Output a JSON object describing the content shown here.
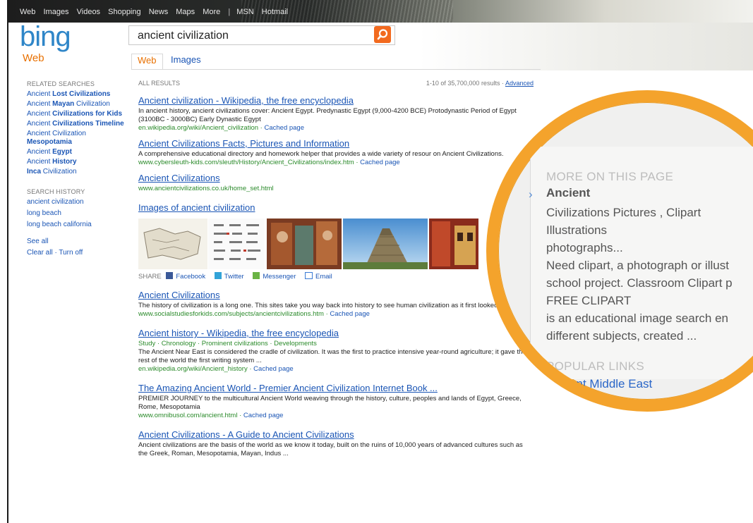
{
  "topnav": [
    "Web",
    "Images",
    "Videos",
    "Shopping",
    "News",
    "Maps",
    "More",
    "|",
    "MSN",
    "Hotmail"
  ],
  "logo": "bing",
  "vertical": "Web",
  "search": {
    "value": "ancient civilization"
  },
  "tabs": {
    "web": "Web",
    "images": "Images"
  },
  "sidebar": {
    "related_heading": "RELATED SEARCHES",
    "related": [
      {
        "pre": "Ancient ",
        "bold": "Lost Civilizations",
        "post": ""
      },
      {
        "pre": "Ancient ",
        "bold": "Mayan",
        "post": " Civilization"
      },
      {
        "pre": "Ancient ",
        "bold": "Civilizations for Kids",
        "post": ""
      },
      {
        "pre": "Ancient ",
        "bold": "Civilizations Timeline",
        "post": ""
      },
      {
        "pre": "Ancient Civilization ",
        "bold": "Mesopotamia",
        "post": ""
      },
      {
        "pre": "Ancient ",
        "bold": "Egypt",
        "post": ""
      },
      {
        "pre": "Ancient ",
        "bold": "History",
        "post": ""
      },
      {
        "pre": "",
        "bold": "Inca",
        "post": " Civilization"
      }
    ],
    "history_heading": "SEARCH HISTORY",
    "history": [
      "ancient civilization",
      "long beach",
      "long beach california"
    ],
    "see_all": "See all",
    "clear_all": "Clear all · Turn off"
  },
  "results_header": {
    "label": "ALL RESULTS",
    "count": "1-10 of 35,700,000 results ·",
    "advanced": "Advanced"
  },
  "results": [
    {
      "title": "Ancient civilization - Wikipedia, the free encyclopedia",
      "snippet": "In ancient history, ancient civilizations cover: Ancient Egypt. Predynastic Egypt (9,000-4200 BCE) Protodynastic Period of Egypt (3100BC - 3000BC) Early Dynastic Egypt",
      "url": "en.wikipedia.org/wiki/Ancient_civilization",
      "cache": "Cached page"
    },
    {
      "title": "Ancient Civilizations Facts, Pictures and Information",
      "snippet": "A comprehensive educational directory and homework helper that provides a wide variety of resour on Ancient Civilizations.",
      "url": "www.cybersleuth-kids.com/sleuth/History/Ancient_Civilizations/index.htm",
      "cache": "Cached page"
    },
    {
      "title": "Ancient Civilizations",
      "snippet": "",
      "url": "www.ancientcivilizations.co.uk/home_set.html",
      "cache": ""
    }
  ],
  "images_block": {
    "title": "Images of ancient civilization",
    "share_label": "SHARE",
    "share": [
      "Facebook",
      "Twitter",
      "Messenger",
      "Email"
    ]
  },
  "results2": [
    {
      "title": "Ancient Civilizations",
      "snippet": "The history of civilization is a long one. This sites take you way back into history to see human civilization as it first looked.",
      "url": "www.socialstudiesforkids.com/subjects/ancientcivilizations.htm",
      "cache": "Cached page",
      "deep": ""
    },
    {
      "title": "Ancient history - Wikipedia, the free encyclopedia",
      "deep": "Study · Chronology · Prominent civilizations · Developments",
      "snippet": "The Ancient Near East is considered the cradle of civilization. It was the first to practice intensive year-round agriculture; it gave the rest of the world the first writing system ...",
      "url": "en.wikipedia.org/wiki/Ancient_history",
      "cache": "Cached page"
    },
    {
      "title": "The Amazing Ancient World - Premier Ancient Civilization Internet Book ...",
      "deep": "",
      "snippet": "PREMIER JOURNEY to the multicultural Ancient World weaving through the history, culture, peoples and lands of Egypt, Greece, Rome, Mesopotamia",
      "url": "www.omnibusol.com/ancient.html",
      "cache": "Cached page"
    },
    {
      "title": "Ancient Civilizations - A Guide to Ancient Civilizations",
      "deep": "",
      "snippet": "Ancient civilizations are the basis of the world as we know it today, built on the ruins of 10,000 years of advanced cultures such as the Greek, Roman, Mesopotamia, Mayan, Indus ...",
      "url": "",
      "cache": ""
    }
  ],
  "zoom": {
    "heading": "MORE ON THIS PAGE",
    "title": "Ancient",
    "lines": [
      "Civilizations Pictures , Clipart",
      "Illustrations",
      "photographs...",
      "Need clipart, a photograph or illust",
      "school project. Classroom Clipart p",
      "FREE CLIPART",
      "is an educational image search en",
      "different subjects, created ..."
    ],
    "popular_heading": "POPULAR LINKS",
    "popular_link": "Ancient Middle East"
  },
  "colors": {
    "brand_orange": "#f26a1f",
    "link_blue": "#1a55b5",
    "url_green": "#2a8a2a",
    "zoom_ring": "#f4a32c"
  }
}
